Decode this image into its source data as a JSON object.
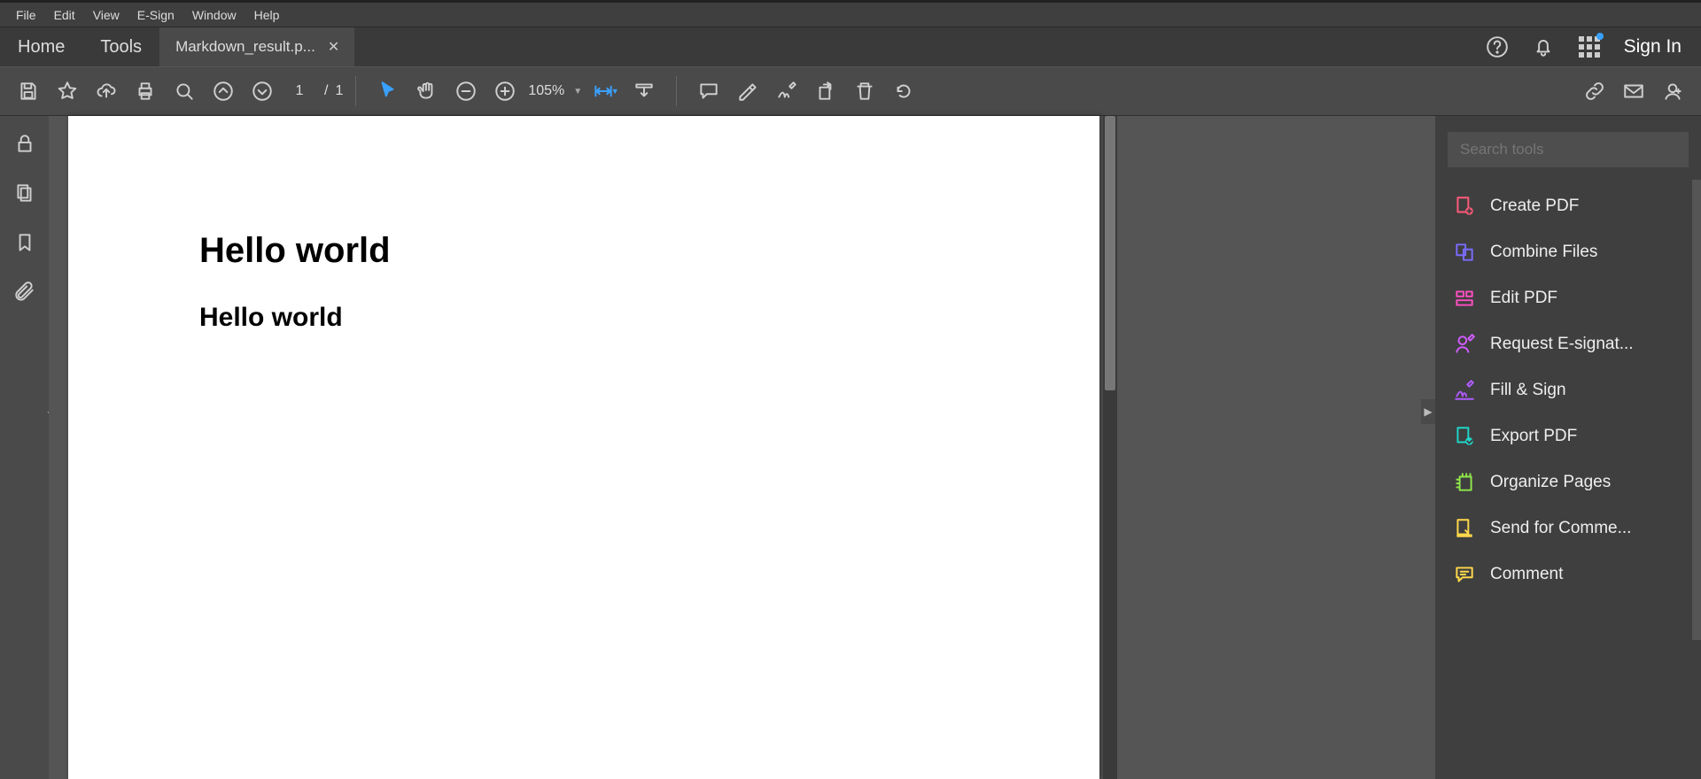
{
  "menu": {
    "items": [
      "File",
      "Edit",
      "View",
      "E-Sign",
      "Window",
      "Help"
    ]
  },
  "tabs": {
    "home": "Home",
    "tools": "Tools",
    "doc": "Markdown_result.p..."
  },
  "header": {
    "signin": "Sign In"
  },
  "toolbar": {
    "page_current": "1",
    "page_sep": "/",
    "page_total": "1",
    "zoom": "105%"
  },
  "document": {
    "heading": "Hello world",
    "subheading": "Hello world"
  },
  "rightpanel": {
    "search_placeholder": "Search tools",
    "tools": [
      {
        "label": "Create PDF",
        "color": "#ff5a7a"
      },
      {
        "label": "Combine Files",
        "color": "#7a6cff"
      },
      {
        "label": "Edit PDF",
        "color": "#ff4fc3"
      },
      {
        "label": "Request E-signat...",
        "color": "#d15cff"
      },
      {
        "label": "Fill & Sign",
        "color": "#b05cff"
      },
      {
        "label": "Export PDF",
        "color": "#1fd6c9"
      },
      {
        "label": "Organize Pages",
        "color": "#8fe84a"
      },
      {
        "label": "Send for Comme...",
        "color": "#ffd94a"
      },
      {
        "label": "Comment",
        "color": "#ffd94a"
      }
    ]
  }
}
